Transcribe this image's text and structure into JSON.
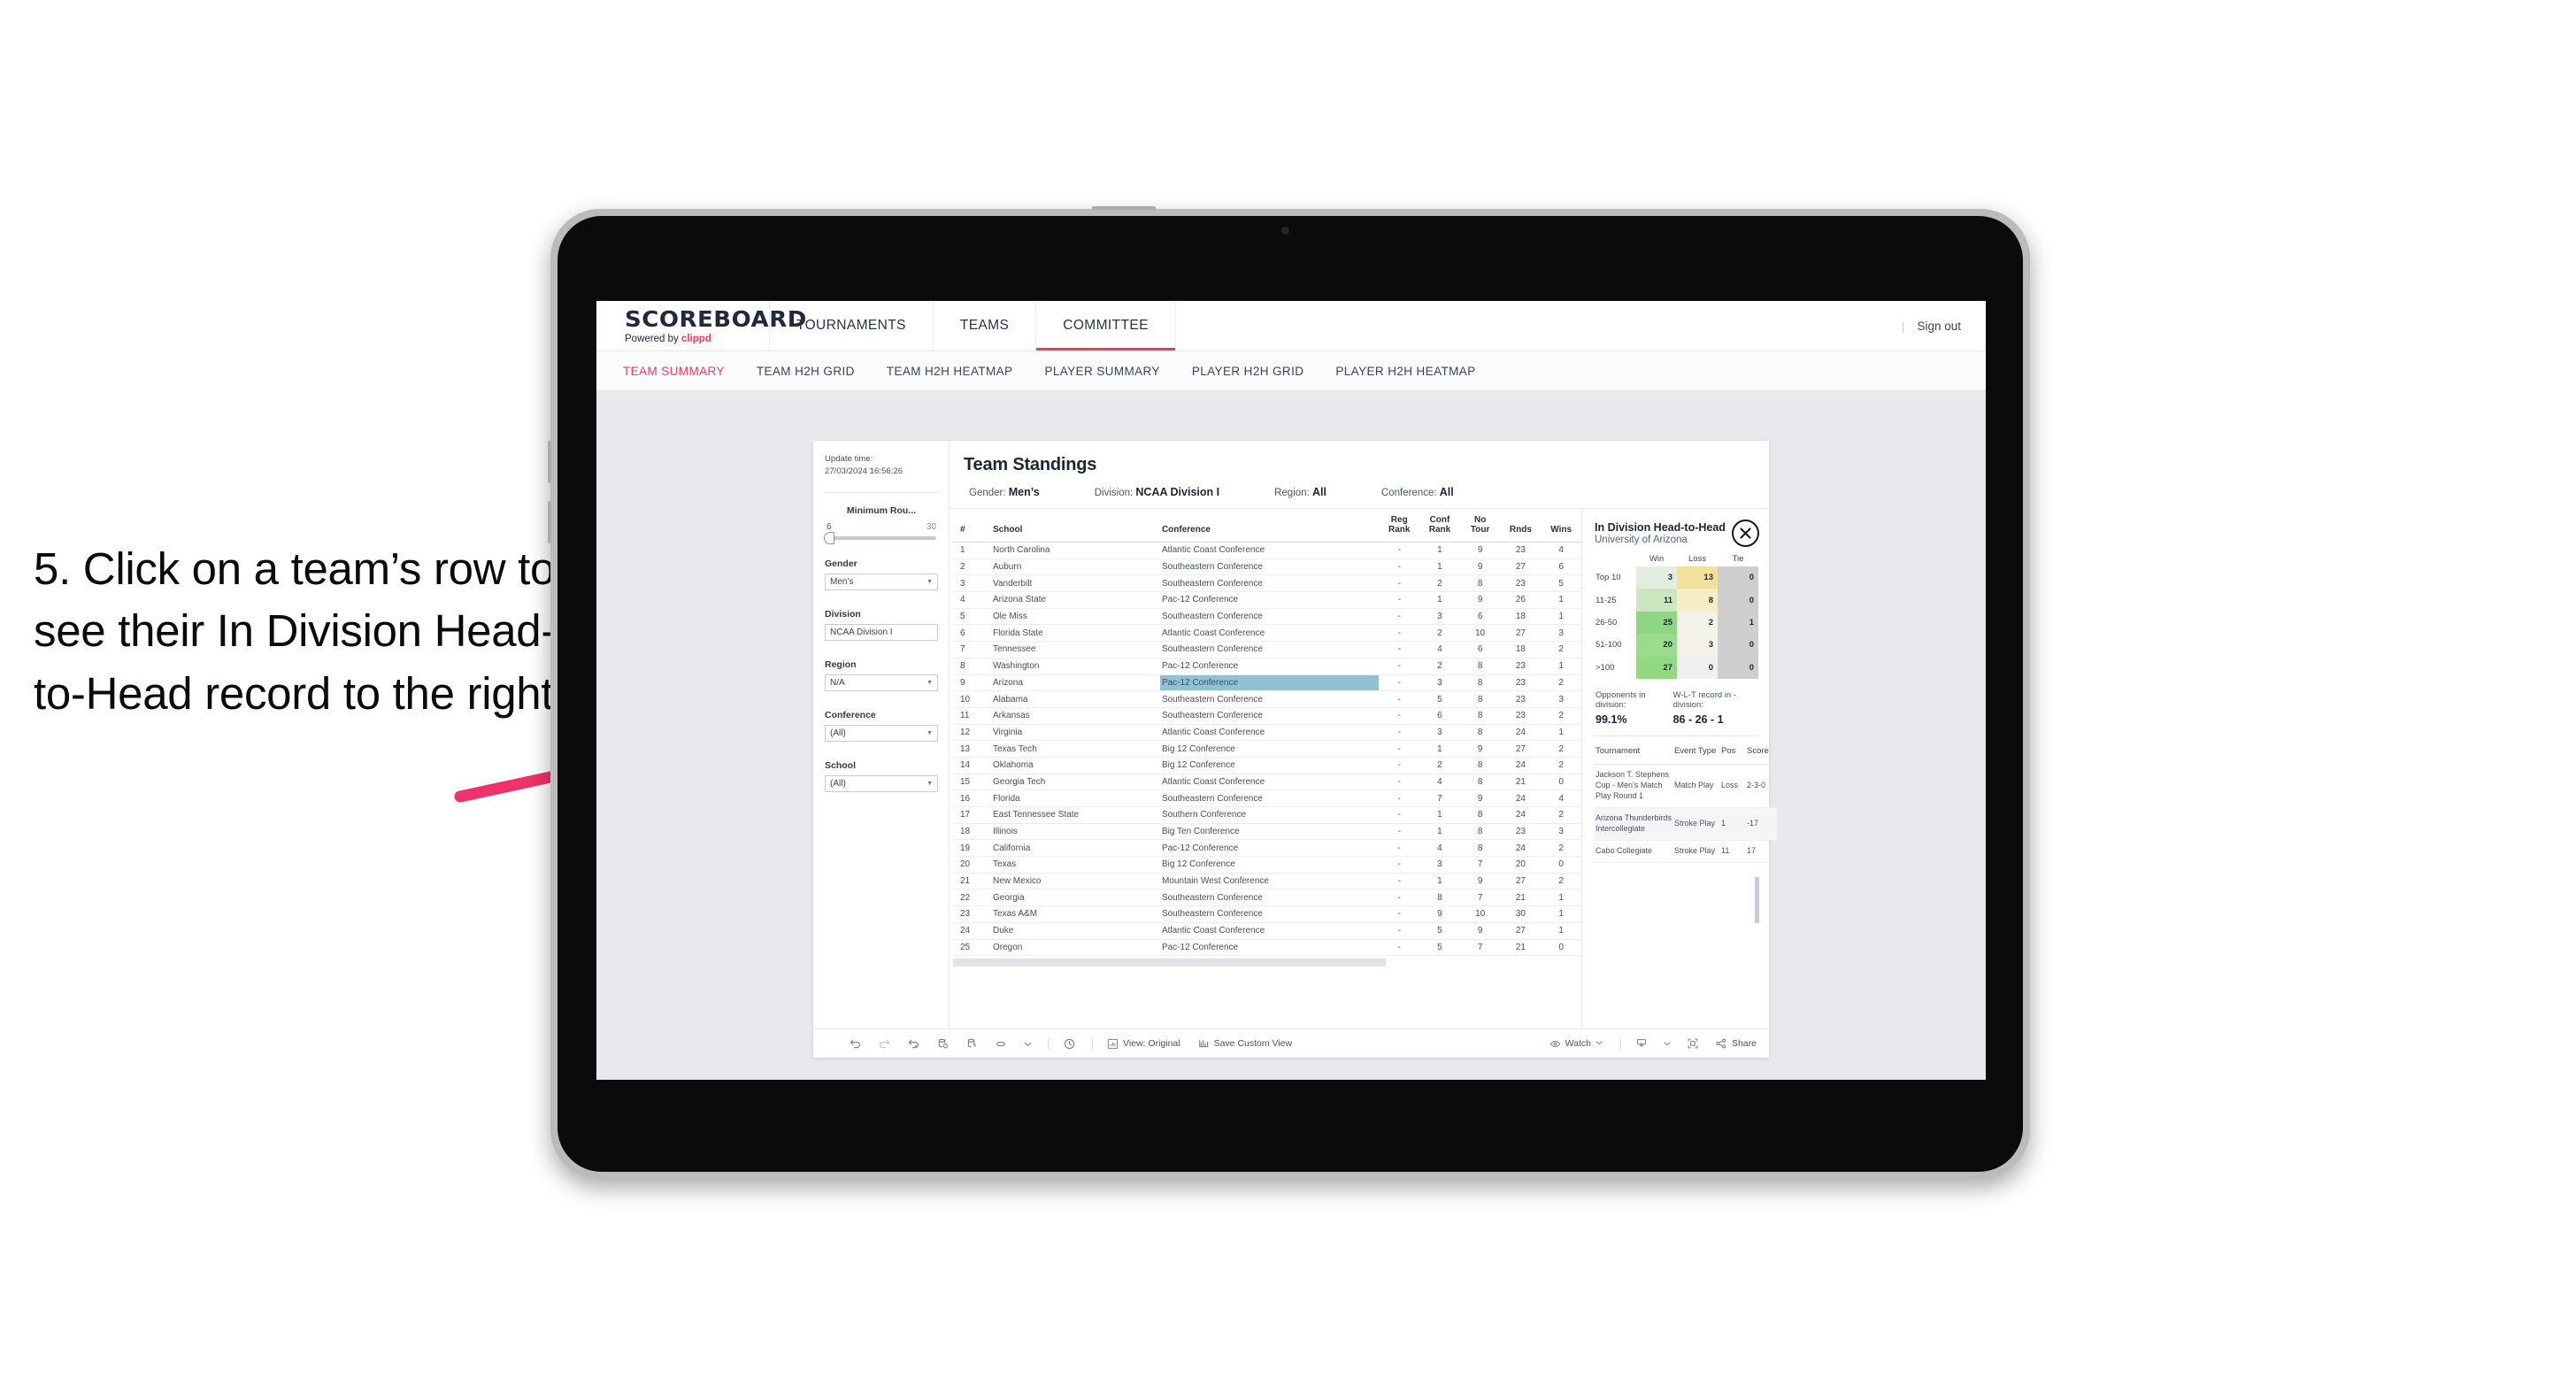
{
  "annotation": {
    "text": "5. Click on a team’s row to see their In Division Head-to-Head record to the right",
    "arrow_color": "#f0326a"
  },
  "header": {
    "logo": "SCOREBOARD",
    "logo_sub_prefix": "Powered by ",
    "logo_sub_brand": "clippd",
    "nav": [
      {
        "label": "TOURNAMENTS",
        "active": false
      },
      {
        "label": "TEAMS",
        "active": false
      },
      {
        "label": "COMMITTEE",
        "active": true
      }
    ],
    "divider": "|",
    "sign_out": "Sign out"
  },
  "subnav": [
    {
      "label": "TEAM SUMMARY",
      "active": true
    },
    {
      "label": "TEAM H2H GRID",
      "active": false
    },
    {
      "label": "TEAM H2H HEATMAP",
      "active": false
    },
    {
      "label": "PLAYER SUMMARY",
      "active": false
    },
    {
      "label": "PLAYER H2H GRID",
      "active": false
    },
    {
      "label": "PLAYER H2H HEATMAP",
      "active": false
    }
  ],
  "filters": {
    "update_time_label": "Update time:",
    "update_time_value": "27/03/2024 16:56:26",
    "slider": {
      "title": "Minimum Rou...",
      "min": "6",
      "max": "30"
    },
    "groups": [
      {
        "label": "Gender",
        "value": "Men’s"
      },
      {
        "label": "Division",
        "value": "NCAA Division I"
      },
      {
        "label": "Region",
        "value": "N/A"
      },
      {
        "label": "Conference",
        "value": "(All)"
      },
      {
        "label": "School",
        "value": "(All)"
      }
    ]
  },
  "standings": {
    "title": "Team Standings",
    "meta": [
      {
        "label": "Gender:",
        "value": "Men’s"
      },
      {
        "label": "Division:",
        "value": "NCAA Division I"
      },
      {
        "label": "Region:",
        "value": "All"
      },
      {
        "label": "Conference:",
        "value": "All"
      }
    ],
    "columns": [
      "#",
      "School",
      "Conference",
      "Reg Rank",
      "Conf Rank",
      "No Tour",
      "Rnds",
      "Wins"
    ],
    "highlight_row_index": 8,
    "rows": [
      [
        "1",
        "North Carolina",
        "Atlantic Coast Conference",
        "-",
        "1",
        "9",
        "23",
        "4"
      ],
      [
        "2",
        "Auburn",
        "Southeastern Conference",
        "-",
        "1",
        "9",
        "27",
        "6"
      ],
      [
        "3",
        "Vanderbilt",
        "Southeastern Conference",
        "-",
        "2",
        "8",
        "23",
        "5"
      ],
      [
        "4",
        "Arizona State",
        "Pac-12 Conference",
        "-",
        "1",
        "9",
        "26",
        "1"
      ],
      [
        "5",
        "Ole Miss",
        "Southeastern Conference",
        "-",
        "3",
        "6",
        "18",
        "1"
      ],
      [
        "6",
        "Florida State",
        "Atlantic Coast Conference",
        "-",
        "2",
        "10",
        "27",
        "3"
      ],
      [
        "7",
        "Tennessee",
        "Southeastern Conference",
        "-",
        "4",
        "6",
        "18",
        "2"
      ],
      [
        "8",
        "Washington",
        "Pac-12 Conference",
        "-",
        "2",
        "8",
        "23",
        "1"
      ],
      [
        "9",
        "Arizona",
        "Pac-12 Conference",
        "-",
        "3",
        "8",
        "23",
        "2"
      ],
      [
        "10",
        "Alabama",
        "Southeastern Conference",
        "-",
        "5",
        "8",
        "23",
        "3"
      ],
      [
        "11",
        "Arkansas",
        "Southeastern Conference",
        "-",
        "6",
        "8",
        "23",
        "2"
      ],
      [
        "12",
        "Virginia",
        "Atlantic Coast Conference",
        "-",
        "3",
        "8",
        "24",
        "1"
      ],
      [
        "13",
        "Texas Tech",
        "Big 12 Conference",
        "-",
        "1",
        "9",
        "27",
        "2"
      ],
      [
        "14",
        "Oklahoma",
        "Big 12 Conference",
        "-",
        "2",
        "8",
        "24",
        "2"
      ],
      [
        "15",
        "Georgia Tech",
        "Atlantic Coast Conference",
        "-",
        "4",
        "8",
        "21",
        "0"
      ],
      [
        "16",
        "Florida",
        "Southeastern Conference",
        "-",
        "7",
        "9",
        "24",
        "4"
      ],
      [
        "17",
        "East Tennessee State",
        "Southern Conference",
        "-",
        "1",
        "8",
        "24",
        "2"
      ],
      [
        "18",
        "Illinois",
        "Big Ten Conference",
        "-",
        "1",
        "8",
        "23",
        "3"
      ],
      [
        "19",
        "California",
        "Pac-12 Conference",
        "-",
        "4",
        "8",
        "24",
        "2"
      ],
      [
        "20",
        "Texas",
        "Big 12 Conference",
        "-",
        "3",
        "7",
        "20",
        "0"
      ],
      [
        "21",
        "New Mexico",
        "Mountain West Conference",
        "-",
        "1",
        "9",
        "27",
        "2"
      ],
      [
        "22",
        "Georgia",
        "Southeastern Conference",
        "-",
        "8",
        "7",
        "21",
        "1"
      ],
      [
        "23",
        "Texas A&M",
        "Southeastern Conference",
        "-",
        "9",
        "10",
        "30",
        "1"
      ],
      [
        "24",
        "Duke",
        "Atlantic Coast Conference",
        "-",
        "5",
        "9",
        "27",
        "1"
      ],
      [
        "25",
        "Oregon",
        "Pac-12 Conference",
        "-",
        "5",
        "7",
        "21",
        "0"
      ]
    ]
  },
  "h2h": {
    "title": "In Division Head-to-Head",
    "subtitle": "University of Arizona",
    "close_icon": "close-icon",
    "columns": [
      "",
      "Win",
      "Loss",
      "Tie"
    ],
    "rows": [
      {
        "band": "Top 10",
        "win": "3",
        "loss": "13",
        "tie": "0",
        "win_color": "#e3eee1",
        "loss_color": "#f3e09a",
        "tie_color": "#cfcfcf"
      },
      {
        "band": "11-25",
        "win": "11",
        "loss": "8",
        "tie": "0",
        "win_color": "#cbe6c0",
        "loss_color": "#f6ecc6",
        "tie_color": "#cfcfcf"
      },
      {
        "band": "26-50",
        "win": "25",
        "loss": "2",
        "tie": "1",
        "win_color": "#8ed683",
        "loss_color": "#f2f1ea",
        "tie_color": "#cfcfcf"
      },
      {
        "band": "51-100",
        "win": "20",
        "loss": "3",
        "tie": "0",
        "win_color": "#9bdb8c",
        "loss_color": "#f4f1e7",
        "tie_color": "#cfcfcf"
      },
      {
        "band": ">100",
        "win": "27",
        "loss": "0",
        "tie": "0",
        "win_color": "#93d982",
        "loss_color": "#f0f0f0",
        "tie_color": "#cfcfcf"
      }
    ],
    "stats": [
      {
        "label": "Opponents in division:",
        "value": "99.1%"
      },
      {
        "label": "W-L-T record in -division:",
        "value": "86 - 26 - 1"
      }
    ],
    "tournament_columns": [
      "Tournament",
      "Event Type",
      "Pos",
      "Score"
    ],
    "tournaments": [
      [
        "Jackson T. Stephens Cup - Men’s Match Play Round 1",
        "Match Play",
        "Loss",
        "2-3-0"
      ],
      [
        "Arizona Thunderbirds Intercollegiate",
        "Stroke Play",
        "1",
        "-17"
      ],
      [
        "Cabo Collegiate",
        "Stroke Play",
        "11",
        "17"
      ]
    ]
  },
  "toolbar": {
    "view_label": "View: Original",
    "save_label": "Save Custom View",
    "watch_label": "Watch",
    "share_label": "Share"
  }
}
